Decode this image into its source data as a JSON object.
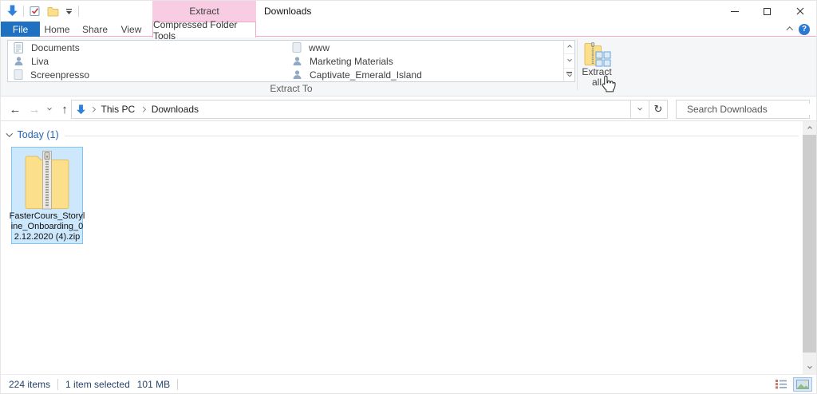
{
  "window": {
    "title": "Downloads",
    "contextual_header": "Extract"
  },
  "tabs": {
    "file": "File",
    "home": "Home",
    "share": "Share",
    "view": "View",
    "contextual": "Compressed Folder Tools"
  },
  "ribbon": {
    "group_label": "Extract To",
    "gallery_left": [
      {
        "label": "Documents",
        "icon": "document-icon"
      },
      {
        "label": "Liva",
        "icon": "user-icon"
      },
      {
        "label": "Screenpresso",
        "icon": "file-icon"
      }
    ],
    "gallery_right": [
      {
        "label": "www",
        "icon": "file-icon"
      },
      {
        "label": "Marketing Materials",
        "icon": "user-icon"
      },
      {
        "label": "Captivate_Emerald_Island",
        "icon": "user-icon"
      }
    ],
    "extract_all": {
      "line1": "Extract",
      "line2": "all"
    }
  },
  "address": {
    "crumb_root": "This PC",
    "crumb_current": "Downloads",
    "search_placeholder": "Search Downloads"
  },
  "main": {
    "group_header": "Today (1)",
    "file": {
      "line1": "FasterCours_Storyl",
      "line2": "ine_Onboarding_0",
      "line3": "2.12.2020 (4).zip"
    }
  },
  "status": {
    "total": "224 items",
    "selected": "1 item selected",
    "size": "101 MB"
  },
  "icons": {
    "back": "←",
    "forward": "→",
    "up": "↑",
    "refresh": "↻",
    "help": "?"
  },
  "colors": {
    "accent_pink": "#f8cce2",
    "accent_pink_border": "#f1a9c8",
    "file_tab_blue": "#1f70c0",
    "selection_bg": "#cde8fd",
    "selection_border": "#84c3ee",
    "group_header_blue": "#2264b5",
    "status_text": "#26436b",
    "download_arrow_blue": "#2f80da",
    "zip_folder_yellow": "#fbdf8a"
  }
}
